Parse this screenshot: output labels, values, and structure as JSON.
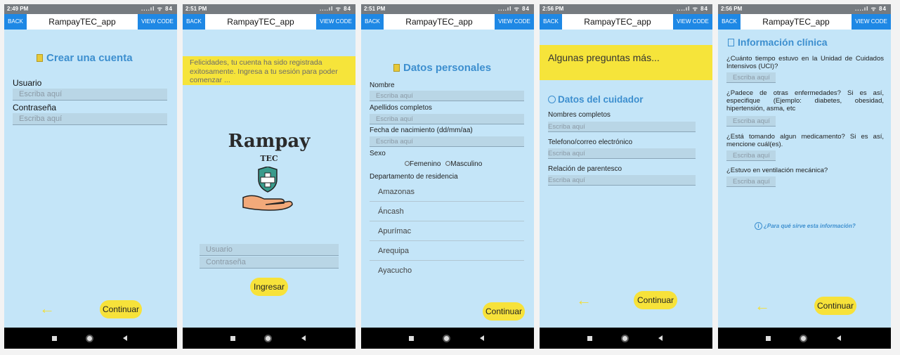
{
  "app": {
    "title": "RampayTEC_app",
    "back_label": "BACK",
    "view_code_label": "VIEW CODE",
    "signal": "....ıl ᯤ 84"
  },
  "screens": [
    {
      "time": "2:49 PM",
      "title": "Crear una cuenta",
      "user_label": "Usuario",
      "user_placeholder": "Escriba aquí",
      "password_label": "Contraseña",
      "password_placeholder": "Escriba aquí",
      "continue_label": "Continuar"
    },
    {
      "time": "2:51 PM",
      "banner_text": "Felicidades, tu cuenta ha sido registrada exitosamente. Ingresa a tu sesión para poder comenzar ...",
      "logo_text": "Rampay",
      "logo_sub": "TEC",
      "user_placeholder": "Usuario",
      "password_placeholder": "Contraseña",
      "login_label": "Ingresar"
    },
    {
      "time": "2:51 PM",
      "title": "Datos personales",
      "name_label": "Nombre",
      "name_placeholder": "Escriba aquí",
      "surname_label": "Apellidos completos",
      "surname_placeholder": "Escriba aquí",
      "birth_label": "Fecha de nacimiento (dd/mm/aa)",
      "birth_placeholder": "Escriba aquí",
      "sex_label": "Sexo",
      "sex_options": [
        "Femenino",
        "Masculino"
      ],
      "department_label": "Departamento de residencia",
      "departments": [
        "Amazonas",
        "Áncash",
        "Apurímac",
        "Arequipa",
        "Ayacucho"
      ],
      "continue_label": "Continuar"
    },
    {
      "time": "2:56 PM",
      "banner_text": "Algunas preguntas más...",
      "title": "Datos del cuidador",
      "name_label": "Nombres completos",
      "name_placeholder": "Escriba aquí",
      "contact_label": "Telefono/correo electrónico",
      "contact_placeholder": "Escriba aquí",
      "relation_label": "Relación de parentesco",
      "relation_placeholder": "Escriba aquí",
      "continue_label": "Continuar"
    },
    {
      "time": "2:56 PM",
      "title": "Información clínica",
      "q1": "¿Cuánto tiempo estuvo en la Unidad de Cuidados Intensivos (UCI)?",
      "q1_placeholder": "Escriba aquí",
      "q2": "¿Padece de otras enfermedades? Si es así, especifique (Ejemplo: diabetes, obesidad, hipertensión, asma, etc",
      "q2_placeholder": "Escriba aquí",
      "q3": "¿Está tomando algun medicamento? Si es así, mencione cuál(es).",
      "q3_placeholder": "Escriba aquí",
      "q4": "¿Estuvo en ventilación mecánica?",
      "q4_placeholder": "Escriba aquí",
      "info_link": "¿Para qué sirve esta información?",
      "continue_label": "Continuar"
    }
  ]
}
